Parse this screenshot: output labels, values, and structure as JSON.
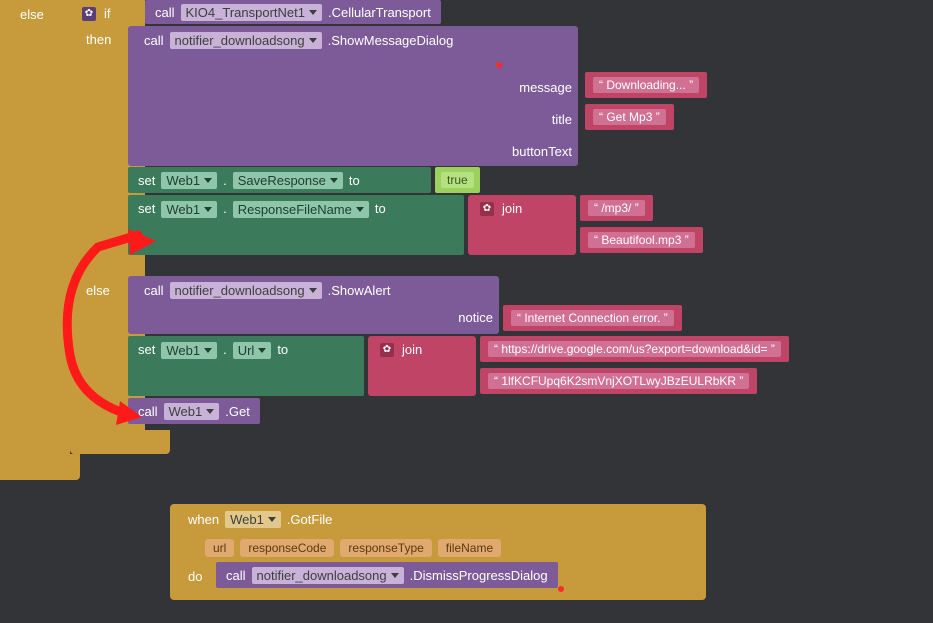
{
  "outer": {
    "else": "else"
  },
  "ifblock": {
    "if": "if",
    "then": "then",
    "else": "else",
    "call": "call",
    "set": "set",
    "to": "to",
    "join": "join"
  },
  "comp": {
    "kio4": "KIO4_TransportNet1",
    "cellular": ".CellularTransport",
    "notifier": "notifier_downloadsong",
    "showDialog": ".ShowMessageDialog",
    "showAlert": ".ShowAlert",
    "web1": "Web1",
    "saveResponse": "SaveResponse",
    "responseFileName": "ResponseFileName",
    "url": "Url",
    "get": ".Get",
    "dismiss": ".DismissProgressDialog"
  },
  "params": {
    "message": "message",
    "title": "title",
    "buttonText": "buttonText",
    "notice": "notice"
  },
  "strings": {
    "downloading": "Downloading...",
    "getMp3": "Get Mp3",
    "true": "true",
    "mp3dir": "/mp3/",
    "beautifool": "Beautifool.mp3",
    "inet": "Internet Connection error.",
    "driveUrl": "https://drive.google.com/us?export=download&id=",
    "driveId": "1lfKCFUpq6K2smVnjXOTLwyJBzEULRbKR"
  },
  "when": {
    "when": "when",
    "gotFile": ".GotFile",
    "do": "do",
    "call": "call",
    "url": "url",
    "responseCode": "responseCode",
    "responseType": "responseType",
    "fileName": "fileName"
  }
}
